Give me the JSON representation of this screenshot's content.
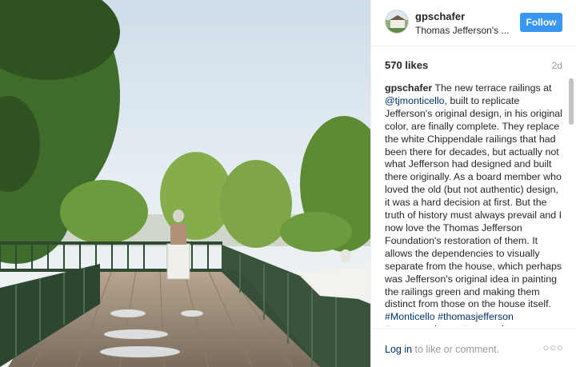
{
  "post": {
    "username": "gpschafer",
    "location": "Thomas Jefferson's ...",
    "follow_label": "Follow",
    "likes": "570 likes",
    "age": "2d",
    "caption": {
      "user": "gpschafer",
      "text_a": " The new terrace railings at ",
      "mention": "@tjmonticello",
      "text_b": ", built to replicate Jefferson's original design, in his original color, are finally complete. They replace the white Chippendale railings that had been there for decades, but actually not what Jefferson had designed and built there originally. As a board member who loved the old (but not authentic) design, it was a hard decision at first. But the truth of history must always prevail and I now love the Thomas Jefferson Foundation's restoration of them. It allows the dependencies to visually separate from the house, which perhaps was Jefferson's original idea in painting the railings green and making them distinct from those on the house itself.",
      "tags": "#Monticello #thomasjefferson #gastonandwyatt #restoration"
    },
    "footer": {
      "login_link": "Log in",
      "login_suffix": " to like or comment.",
      "more_icon": "more-options-icon"
    }
  },
  "colors": {
    "follow_bg": "#3897f0",
    "link": "#003569",
    "muted": "#999999"
  }
}
